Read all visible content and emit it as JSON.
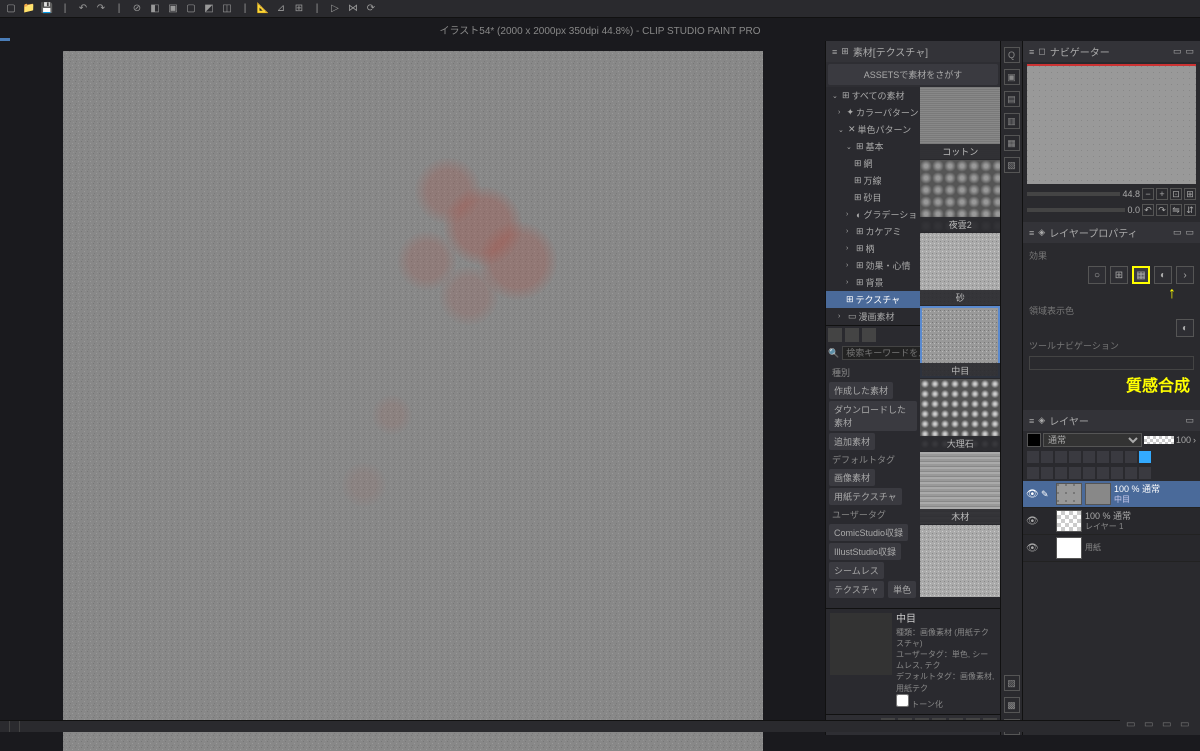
{
  "title": "イラスト54* (2000 x 2000px 350dpi 44.8%)   - CLIP STUDIO PAINT PRO",
  "material_panel": {
    "header": "素材[テクスチャ]",
    "assets_btn": "ASSETSで素材をさがす",
    "search_placeholder": "検索キーワードを入...",
    "tree": {
      "all": "すべての素材",
      "color_pattern": "カラーパターン",
      "mono_pattern": "単色パターン",
      "basic": "基本",
      "net": "網",
      "lines": "万線",
      "sand": "砂目",
      "gradation": "グラデーショ",
      "kakeami": "カケアミ",
      "pattern": "柄",
      "effect": "効果・心情",
      "background": "背景",
      "texture": "テクスチャ",
      "manga": "漫画素材"
    },
    "thumbs": [
      {
        "label": "コットン",
        "cls": "tex-cotton"
      },
      {
        "label": "夜雲2",
        "cls": "tex-cloud"
      },
      {
        "label": "砂",
        "cls": "tex-sand"
      },
      {
        "label": "中目",
        "cls": "tex-med",
        "sel": true
      },
      {
        "label": "大理石",
        "cls": "tex-marble"
      },
      {
        "label": "木材",
        "cls": "tex-wood"
      },
      {
        "label": "",
        "cls": "tex-sand"
      }
    ],
    "tags": {
      "kind_hd": "種別",
      "kind": [
        "作成した素材",
        "ダウンロードした素材",
        "追加素材"
      ],
      "default_hd": "デフォルトタグ",
      "default": [
        "画像素材",
        "用紙テクスチャ"
      ],
      "user_hd": "ユーザータグ",
      "user": [
        "ComicStudio収録",
        "IllustStudio収録",
        "シームレス",
        "テクスチャ",
        "単色"
      ]
    },
    "detail": {
      "name": "中目",
      "type_lbl": "種類：",
      "type": "画像素材 (用紙テクスチャ)",
      "utag_lbl": "ユーザータグ：",
      "utag": "単色, シームレス, テク",
      "dtag_lbl": "デフォルトタグ：",
      "dtag": "画像素材, 用紙テク",
      "tone": "トーン化"
    }
  },
  "navigator": {
    "header": "ナビゲーター",
    "zoom": "44.8",
    "rotate": "0.0"
  },
  "layer_property": {
    "header": "レイヤープロパティ",
    "effect_lbl": "効果",
    "region_lbl": "領域表示色",
    "toolnav_lbl": "ツールナビゲーション",
    "callout": "質感合成"
  },
  "layers": {
    "header": "レイヤー",
    "blend": "通常",
    "opacity": "100",
    "items": [
      {
        "name": "100 % 通常",
        "sub": "中目",
        "sel": true,
        "thumb": "tex"
      },
      {
        "name": "100 % 通常",
        "sub": "レイヤー 1",
        "thumb": "checker"
      },
      {
        "name": "",
        "sub": "用紙",
        "thumb": "white"
      }
    ]
  }
}
